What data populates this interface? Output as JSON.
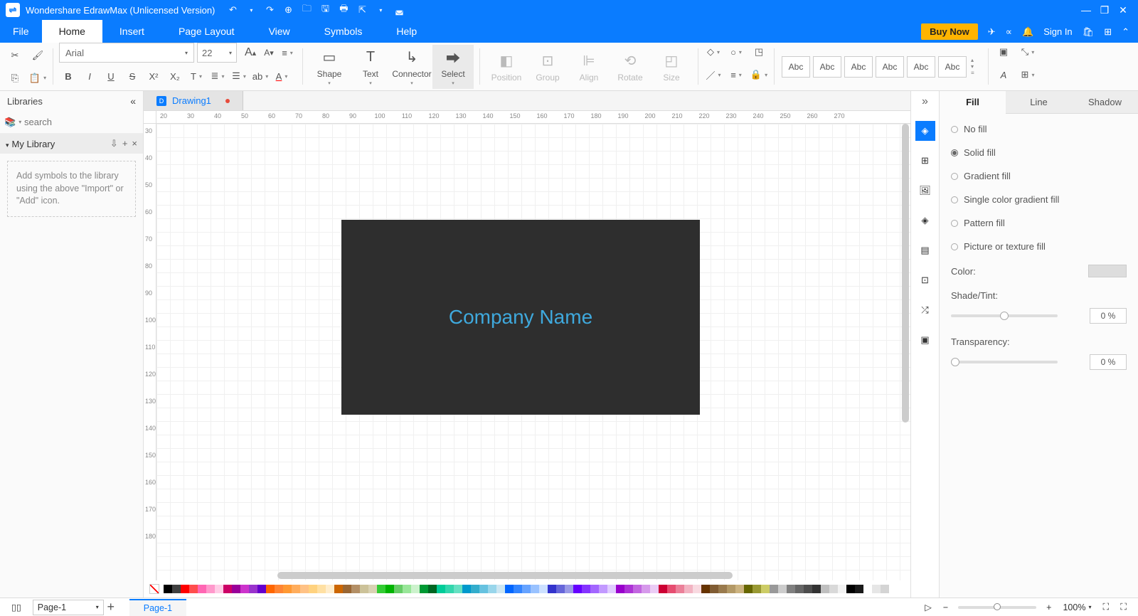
{
  "titlebar": {
    "app_title": "Wondershare EdrawMax (Unlicensed Version)"
  },
  "menubar": {
    "tabs": [
      "File",
      "Home",
      "Insert",
      "Page Layout",
      "View",
      "Symbols",
      "Help"
    ],
    "active_index": 1,
    "buy_label": "Buy Now",
    "signin": "Sign In"
  },
  "toolbar": {
    "font_name": "Arial",
    "font_size": "22",
    "shape_label": "Shape",
    "text_label": "Text",
    "connector_label": "Connector",
    "select_label": "Select",
    "position_label": "Position",
    "group_label": "Group",
    "align_label": "Align",
    "rotate_label": "Rotate",
    "size_label": "Size",
    "style_sample": "Abc"
  },
  "library": {
    "header": "Libraries",
    "search_placeholder": "search",
    "section": "My Library",
    "hint": "Add symbols to the library using the above \"Import\" or \"Add\" icon."
  },
  "document": {
    "tab_name": "Drawing1",
    "shape_text": "Company Name"
  },
  "ruler_top": [
    "20",
    "30",
    "40",
    "50",
    "60",
    "70",
    "80",
    "90",
    "100",
    "110",
    "120",
    "130",
    "140",
    "150",
    "160",
    "170",
    "180",
    "190",
    "200",
    "210",
    "220",
    "230",
    "240",
    "250",
    "260",
    "270"
  ],
  "ruler_left": [
    "30",
    "40",
    "50",
    "60",
    "70",
    "80",
    "90",
    "100",
    "110",
    "120",
    "130",
    "140",
    "150",
    "160",
    "170",
    "180"
  ],
  "prop": {
    "tabs": [
      "Fill",
      "Line",
      "Shadow"
    ],
    "active_index": 0,
    "opts": [
      "No fill",
      "Solid fill",
      "Gradient fill",
      "Single color gradient fill",
      "Pattern fill",
      "Picture or texture fill"
    ],
    "selected_opt": 1,
    "color_label": "Color:",
    "shade_label": "Shade/Tint:",
    "shade_value": "0 %",
    "transp_label": "Transparency:",
    "transp_value": "0 %"
  },
  "statusbar": {
    "page_selector": "Page-1",
    "page_tab": "Page-1",
    "zoom": "100%"
  },
  "colorbar": [
    "#000000",
    "#404040",
    "#ff0000",
    "#ff4d4d",
    "#ff66b3",
    "#ff99cc",
    "#ffcce6",
    "#cc0066",
    "#990099",
    "#cc33cc",
    "#9933cc",
    "#6600cc",
    "#ff6600",
    "#ff8533",
    "#ff9933",
    "#ffad5c",
    "#ffc285",
    "#ffd27f",
    "#ffe0a3",
    "#ffedcc",
    "#cc6600",
    "#996633",
    "#b38f66",
    "#ccc299",
    "#d9d2b3",
    "#33cc33",
    "#00b300",
    "#66cc66",
    "#99e699",
    "#ccf2cc",
    "#009933",
    "#006622",
    "#00cc99",
    "#33d6ad",
    "#66e0c2",
    "#0099cc",
    "#33adcc",
    "#66c2e0",
    "#99d6eb",
    "#cce6f2",
    "#0066ff",
    "#3385ff",
    "#66a3ff",
    "#99c2ff",
    "#cce0ff",
    "#3333cc",
    "#6666d9",
    "#9999e6",
    "#6600ff",
    "#8533ff",
    "#a366ff",
    "#c299ff",
    "#e0ccff",
    "#9900cc",
    "#ad33d6",
    "#c266e0",
    "#d699eb",
    "#ebccf5",
    "#cc0033",
    "#e64d70",
    "#eb8099",
    "#f2b3c2",
    "#f8d9e0",
    "#663300",
    "#805c33",
    "#997a4d",
    "#b39966",
    "#ccb380",
    "#666600",
    "#999933",
    "#cccc66",
    "#999999",
    "#cccccc",
    "#808080",
    "#666666",
    "#4d4d4d",
    "#333333",
    "#bfbfbf",
    "#d9d9d9",
    "#f2f2f2",
    "#000000",
    "#1a1a1a",
    "#ffffff",
    "#e6e6e6",
    "#d4d4d4"
  ]
}
